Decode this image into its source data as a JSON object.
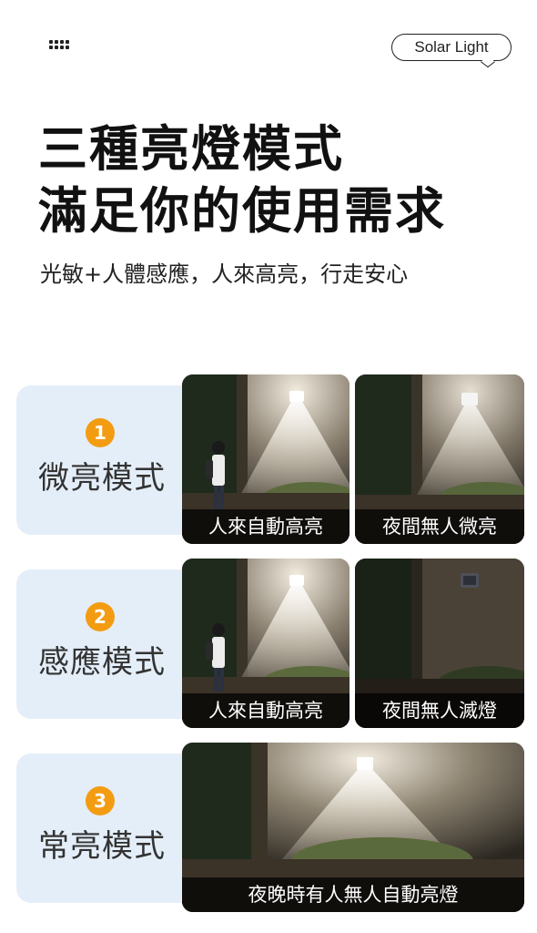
{
  "header": {
    "menu_icon": "grid-dots-icon",
    "brand_label": "Solar Light"
  },
  "hero": {
    "title_line1": "三種亮燈模式",
    "title_line2": "滿足你的使用需求",
    "subtitle": "光敏+人體感應，人來高亮，行走安心"
  },
  "modes": [
    {
      "number": "1",
      "name": "微亮模式",
      "photos": [
        {
          "caption": "人來自動高亮"
        },
        {
          "caption": "夜間無人微亮"
        }
      ]
    },
    {
      "number": "2",
      "name": "感應模式",
      "photos": [
        {
          "caption": "人來自動高亮"
        },
        {
          "caption": "夜間無人滅燈"
        }
      ]
    },
    {
      "number": "3",
      "name": "常亮模式",
      "photos": [
        {
          "caption": "夜晚時有人無人自動亮燈"
        }
      ]
    }
  ],
  "colors": {
    "badge": "#f39c12",
    "label_bg": "#e4eef9",
    "text_dark": "#111111"
  }
}
